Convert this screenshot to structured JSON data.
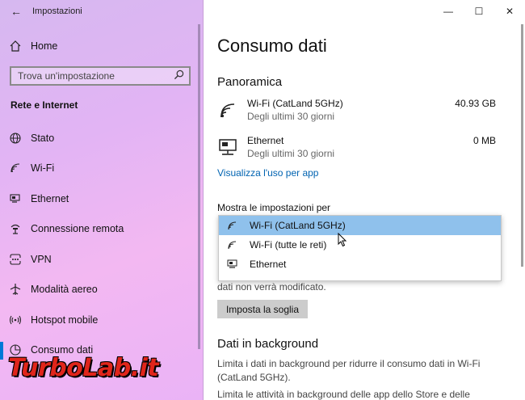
{
  "window": {
    "title": "Impostazioni",
    "controls": {
      "minimize": "—",
      "maximize": "☐",
      "close": "✕"
    }
  },
  "sidebar": {
    "home_label": "Home",
    "search_placeholder": "Trova un'impostazione",
    "section_title": "Rete e Internet",
    "items": [
      {
        "label": "Stato",
        "icon": "globe-icon"
      },
      {
        "label": "Wi-Fi",
        "icon": "wifi-icon"
      },
      {
        "label": "Ethernet",
        "icon": "ethernet-icon"
      },
      {
        "label": "Connessione remota",
        "icon": "dial-up-icon"
      },
      {
        "label": "VPN",
        "icon": "vpn-icon"
      },
      {
        "label": "Modalità aereo",
        "icon": "airplane-icon"
      },
      {
        "label": "Hotspot mobile",
        "icon": "hotspot-icon"
      },
      {
        "label": "Consumo dati",
        "icon": "data-usage-icon",
        "active": true
      }
    ]
  },
  "main": {
    "page_title": "Consumo dati",
    "overview_title": "Panoramica",
    "usage": [
      {
        "name": "Wi-Fi (CatLand 5GHz)",
        "period": "Degli ultimi 30 giorni",
        "amount": "40.93 GB",
        "icon": "wifi-icon"
      },
      {
        "name": "Ethernet",
        "period": "Degli ultimi 30 giorni",
        "amount": "0 MB",
        "icon": "ethernet-icon"
      }
    ],
    "view_usage_link": "Visualizza l'uso per app",
    "show_settings_label": "Mostra le impostazioni per",
    "dropdown_options": [
      {
        "label": "Wi-Fi (CatLand 5GHz)",
        "icon": "wifi-icon",
        "selected": true
      },
      {
        "label": "Wi-Fi (tutte le reti)",
        "icon": "wifi-icon",
        "selected": false
      },
      {
        "label": "Ethernet",
        "icon": "ethernet-icon",
        "selected": false
      }
    ],
    "obscured_text": "dati non verrà modificato.",
    "set_limit_button": "Imposta la soglia",
    "background_title": "Dati in background",
    "background_para_1": "Limita i dati in background per ridurre il consumo dati in Wi-Fi (CatLand 5GHz).",
    "background_para_2": "Limita le attività in background delle app dello Store e delle"
  },
  "watermark": {
    "text": "TurboLab.it"
  },
  "colors": {
    "accent": "#0078d7",
    "link": "#0063b1",
    "selection": "#8fc1ec",
    "watermark": "#e0251b"
  }
}
